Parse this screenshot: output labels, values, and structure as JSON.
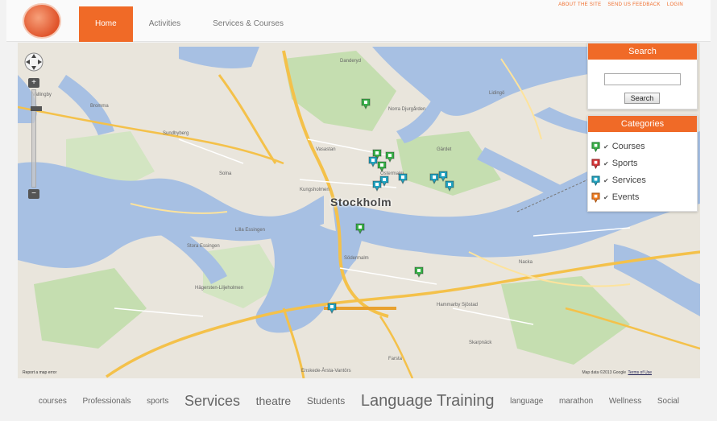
{
  "header": {
    "logo_icon": "site-logo",
    "nav": [
      {
        "label": "Home",
        "active": true
      },
      {
        "label": "Activities",
        "active": false
      },
      {
        "label": "Services & Courses",
        "active": false
      }
    ],
    "top_links": [
      "ABOUT THE SITE",
      "SEND US FEEDBACK",
      "LOGIN"
    ],
    "accent_color": "#f06a27"
  },
  "map": {
    "city": "Stockholm",
    "places": [
      "Vallingby",
      "Bromma",
      "Solna",
      "Lidingö",
      "Nacka",
      "Södermalm",
      "Hägersten-Liljeholmen",
      "Enskede-Årsta-Vantörs",
      "Hammarby Sjöstad",
      "Kungsholmen",
      "Östermalm",
      "Vasastan",
      "Danderyd",
      "Sundbyberg",
      "Farsta",
      "Skarpnäck",
      "Norra Djurgården",
      "Gärdet",
      "Lilla Essingen",
      "Stora Essingen"
    ],
    "copyright": "Map data ©2013 Google",
    "terms": "Terms of Use",
    "report": "Report a map error",
    "controls": {
      "zoom_in": "+",
      "zoom_out": "−"
    },
    "markers": [
      {
        "category": "Courses",
        "color": "#3bb04a",
        "lat": 59.367,
        "lon": 18.045
      },
      {
        "category": "Courses",
        "color": "#3bb04a",
        "lat": 59.346,
        "lon": 18.053
      },
      {
        "category": "Courses",
        "color": "#3bb04a",
        "lat": 59.345,
        "lon": 18.062
      },
      {
        "category": "Courses",
        "color": "#3bb04a",
        "lat": 59.341,
        "lon": 18.056
      },
      {
        "category": "Courses",
        "color": "#3bb04a",
        "lat": 59.315,
        "lon": 18.041
      },
      {
        "category": "Courses",
        "color": "#3bb04a",
        "lat": 59.297,
        "lon": 18.082
      },
      {
        "category": "Services",
        "color": "#23a3c0",
        "lat": 59.343,
        "lon": 18.05
      },
      {
        "category": "Services",
        "color": "#23a3c0",
        "lat": 59.335,
        "lon": 18.058
      },
      {
        "category": "Services",
        "color": "#23a3c0",
        "lat": 59.333,
        "lon": 18.053
      },
      {
        "category": "Services",
        "color": "#23a3c0",
        "lat": 59.336,
        "lon": 18.071
      },
      {
        "category": "Services",
        "color": "#23a3c0",
        "lat": 59.336,
        "lon": 18.093
      },
      {
        "category": "Services",
        "color": "#23a3c0",
        "lat": 59.337,
        "lon": 18.099
      },
      {
        "category": "Services",
        "color": "#23a3c0",
        "lat": 59.333,
        "lon": 18.104
      },
      {
        "category": "Services",
        "color": "#23a3c0",
        "lat": 59.282,
        "lon": 18.021
      }
    ]
  },
  "search": {
    "title": "Search",
    "input_value": "",
    "button_label": "Search"
  },
  "categories": {
    "title": "Categories",
    "items": [
      {
        "label": "Courses",
        "color": "#3bb04a",
        "icon": "green-marker-icon"
      },
      {
        "label": "Sports",
        "color": "#d9383a",
        "icon": "red-marker-icon"
      },
      {
        "label": "Services",
        "color": "#23a3c0",
        "icon": "blue-marker-icon"
      },
      {
        "label": "Events",
        "color": "#f07d22",
        "icon": "orange-marker-icon"
      }
    ]
  },
  "tags": [
    {
      "label": "courses",
      "weight": 1
    },
    {
      "label": "Professionals",
      "weight": 1
    },
    {
      "label": "sports",
      "weight": 1
    },
    {
      "label": "Services",
      "weight": 3
    },
    {
      "label": "theatre",
      "weight": 2
    },
    {
      "label": "Students",
      "weight": 1.5
    },
    {
      "label": "Language Training",
      "weight": 3.5
    },
    {
      "label": "language",
      "weight": 1
    },
    {
      "label": "marathon",
      "weight": 1
    },
    {
      "label": "Wellness",
      "weight": 1
    },
    {
      "label": "Social",
      "weight": 1
    }
  ]
}
